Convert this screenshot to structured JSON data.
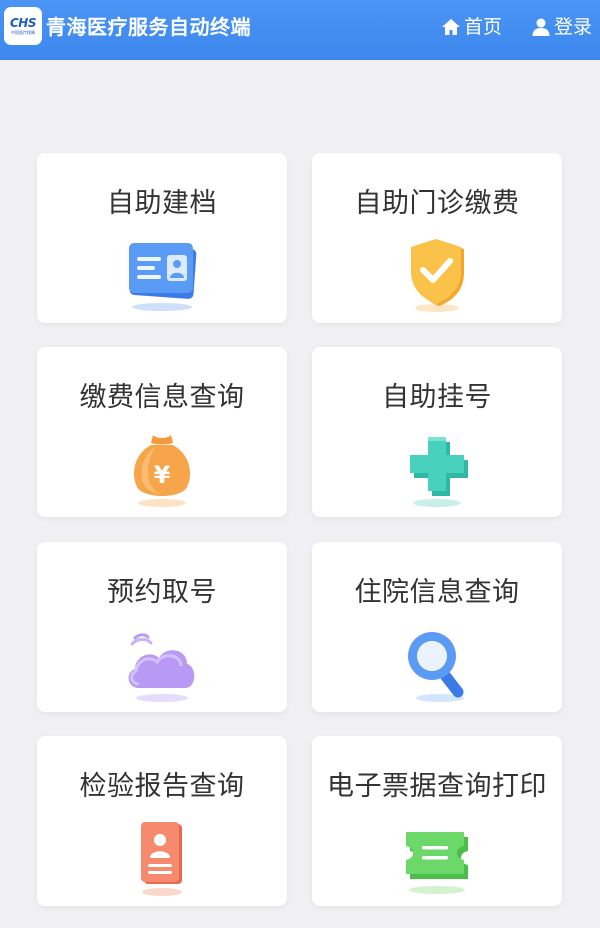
{
  "header": {
    "logo_text": "CHS",
    "logo_subtext": "中国医疗保障",
    "title": "青海医疗服务自动终端",
    "home_label": "首页",
    "login_label": "登录",
    "home_icon": "home-icon",
    "login_icon": "user-icon",
    "background_color": "#3d88ee"
  },
  "cards": [
    {
      "label": "自助建档",
      "icon": "id-card-icon"
    },
    {
      "label": "自助门诊缴费",
      "icon": "shield-check-icon"
    },
    {
      "label": "缴费信息查询",
      "icon": "money-bag-icon"
    },
    {
      "label": "自助挂号",
      "icon": "medical-cross-icon"
    },
    {
      "label": "预约取号",
      "icon": "cloud-icon"
    },
    {
      "label": "住院信息查询",
      "icon": "magnifier-icon"
    },
    {
      "label": "检验报告查询",
      "icon": "report-icon"
    },
    {
      "label": "电子票据查询打印",
      "icon": "ticket-icon"
    }
  ]
}
